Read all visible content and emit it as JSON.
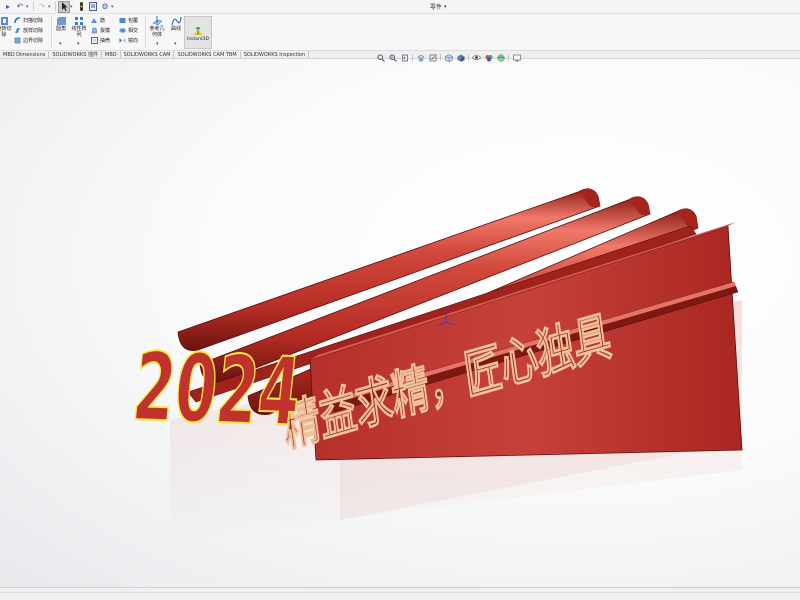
{
  "window": {
    "title": "零件"
  },
  "ribbon": {
    "buttons": {
      "extrude_cut_partial": "旋转切\n除",
      "sweep_cut": "扫描切除",
      "loft_cut": "放样切除",
      "boundary_cut": "边界切除",
      "fillet": "圆角",
      "linear_pattern": "线性阵\n列",
      "rib": "筋",
      "draft": "拔模",
      "shell": "抽壳",
      "wrap": "包覆",
      "intersect": "相交",
      "mirror": "镜向",
      "reference_geometry": "参考几\n何体",
      "curves": "曲线",
      "instant3d": "Instant3D"
    }
  },
  "tabs": [
    "MBD Dimensions",
    "SOLIDWORKS 插件",
    "MBD",
    "SOLIDWORKS CAM",
    "SOLIDWORKS CAM TBM",
    "SOLIDWORKS Inspection"
  ],
  "model": {
    "year_text": "2024",
    "slogan_text": "精益求精，匠心独具",
    "colors": {
      "body": "#c0322c",
      "highlight": "#ef6c5e",
      "shadow": "#7a1612",
      "edge": "#ffe74a"
    }
  },
  "heads_up_icons": [
    "zoom-to-fit-icon",
    "zoom-area-icon",
    "previous-view-icon",
    "section-view-icon",
    "dynamic-annotation-icon",
    "view-orientation-icon",
    "display-style-icon",
    "hide-show-icon",
    "edit-appearance-icon",
    "apply-scene-icon",
    "view-settings-icon"
  ]
}
